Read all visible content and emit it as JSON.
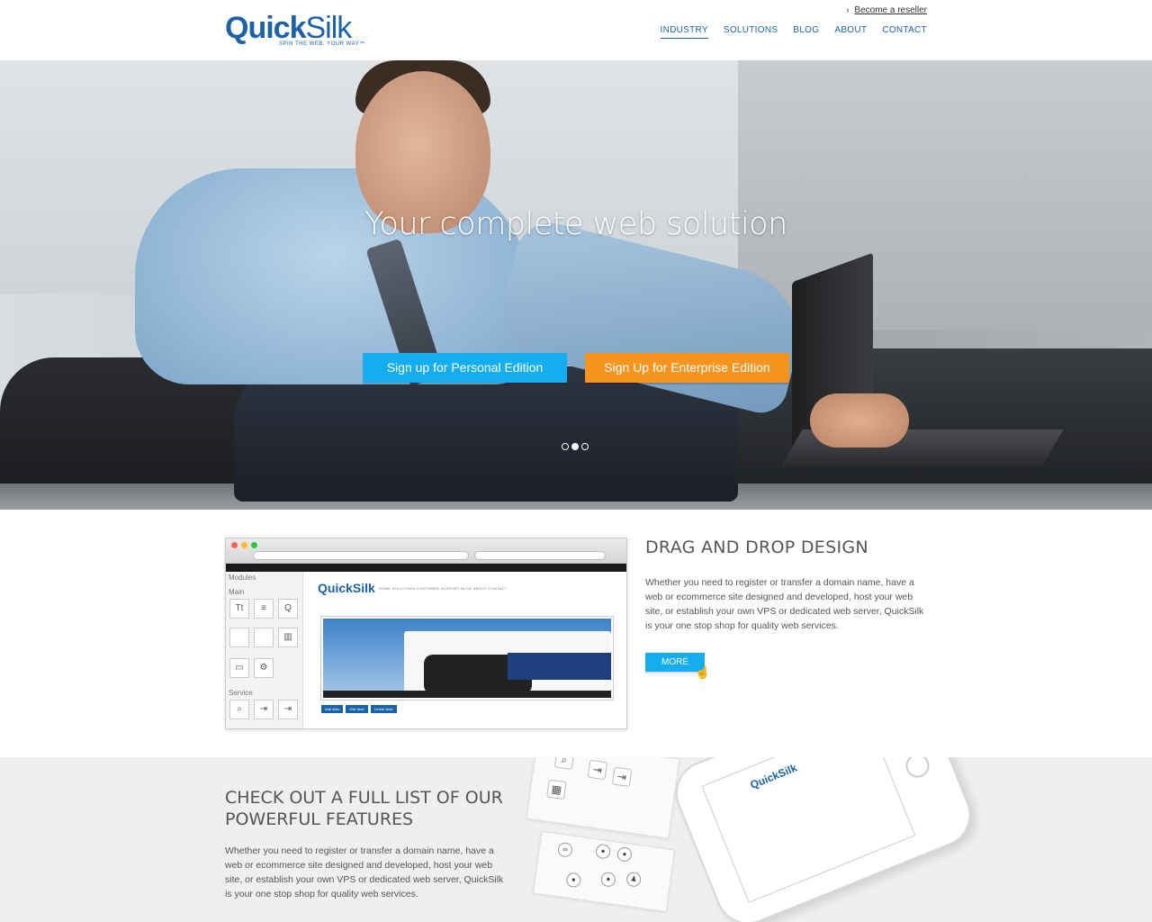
{
  "header": {
    "logo_quick": "Quick",
    "logo_silk": "Silk",
    "logo_tagline": "SPIN THE WEB. YOUR WAY™",
    "reseller_link": "Become a reseller",
    "nav": [
      "INDUSTRY",
      "SOLUTIONS",
      "BLOG",
      "ABOUT",
      "CONTACT"
    ],
    "active_nav": "INDUSTRY"
  },
  "hero": {
    "title": "Your complete web solution",
    "btn_personal": "Sign up for Personal Edition",
    "btn_enterprise": "Sign Up for Enterprise Edition",
    "slides": 3,
    "active_slide": 2,
    "colors": {
      "personal": "#14aef0",
      "enterprise": "#f7941d"
    }
  },
  "drag_drop": {
    "title": "DRAG AND DROP DESIGN",
    "text": "Whether you need to register or transfer a domain name, have a web or ecommerce site designed and developed, host your web site, or establish your own VPS or dedicated web server, QuickSilk is your one stop shop for quality web services.",
    "more_label": "MORE",
    "screenshot": {
      "side_modules": "Modules",
      "side_main": "Main",
      "side_service": "Service",
      "mini_logo": "QuickSilk",
      "mini_nav": "HOME   SOLUTIONS   CUSTOMER SUPPORT   BLOG   ABOUT   CONTACT",
      "mini_buttons": [
        "Add slide",
        "Edit slide",
        "Delete slide"
      ]
    }
  },
  "features": {
    "title": "CHECK OUT A FULL LIST OF OUR POWERFUL FEATURES",
    "text": "Whether you need to register or transfer a domain name, have a web or ecommerce site designed and developed, host your web site, or establish your own VPS or dedicated web server, QuickSilk is your one stop shop for quality web services.",
    "phone_logo": "QuickSilk"
  }
}
